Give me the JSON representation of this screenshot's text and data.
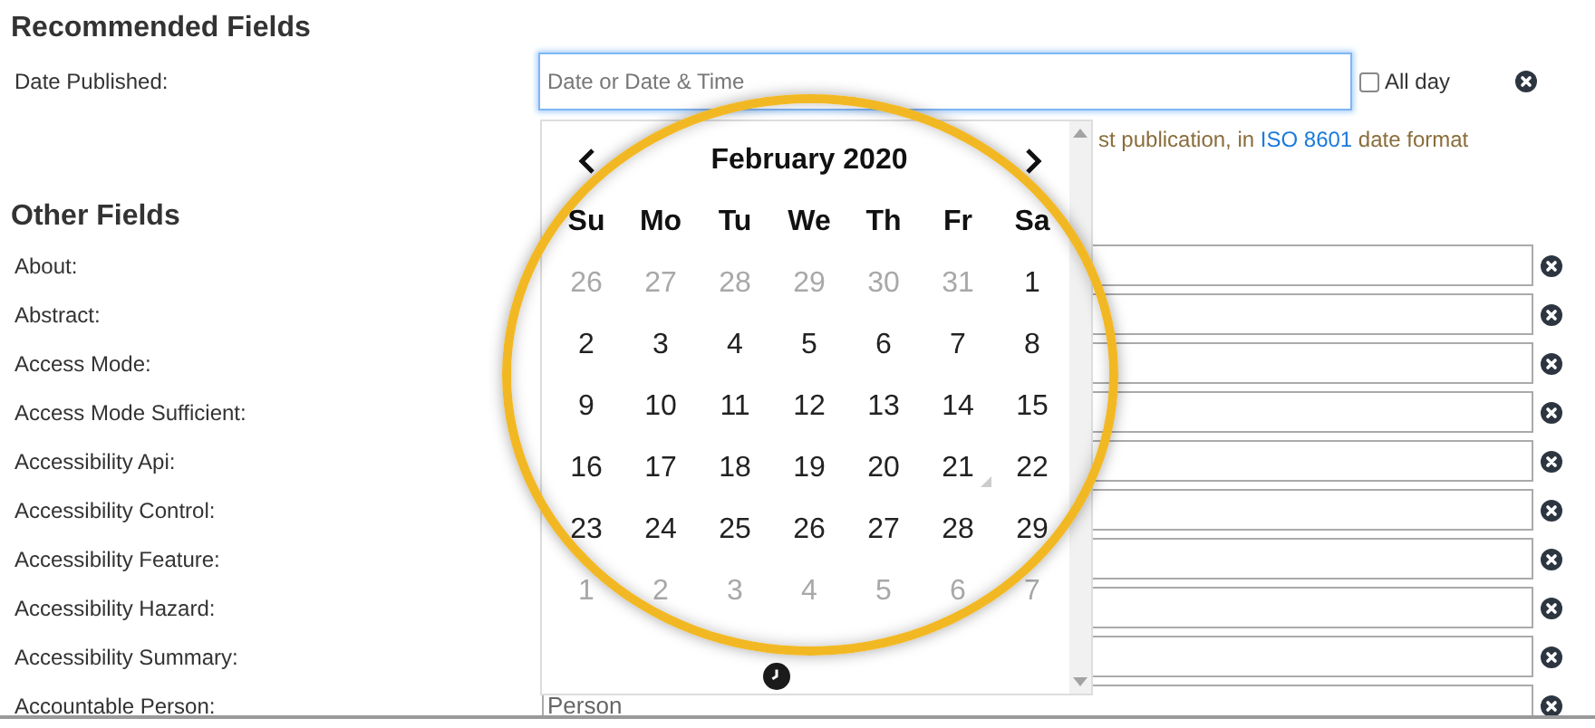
{
  "recommended": {
    "title": "Recommended Fields",
    "date_field": {
      "label": "Date Published:",
      "placeholder": "Date or Date & Time",
      "focused": true
    },
    "all_day": {
      "label": "All day",
      "checked": false
    },
    "help": {
      "before": "st publication, in ",
      "link": "ISO 8601",
      "after": " date format"
    }
  },
  "calendar": {
    "month": "February 2020",
    "weekdays": [
      "Su",
      "Mo",
      "Tu",
      "We",
      "Th",
      "Fr",
      "Sa"
    ],
    "weeks": [
      [
        {
          "day": "26",
          "muted": true,
          "today": false
        },
        {
          "day": "27",
          "muted": true,
          "today": false
        },
        {
          "day": "28",
          "muted": true,
          "today": false
        },
        {
          "day": "29",
          "muted": true,
          "today": false
        },
        {
          "day": "30",
          "muted": true,
          "today": false
        },
        {
          "day": "31",
          "muted": true,
          "today": false
        },
        {
          "day": "1",
          "muted": false,
          "today": false
        }
      ],
      [
        {
          "day": "2",
          "muted": false,
          "today": false
        },
        {
          "day": "3",
          "muted": false,
          "today": false
        },
        {
          "day": "4",
          "muted": false,
          "today": false
        },
        {
          "day": "5",
          "muted": false,
          "today": false
        },
        {
          "day": "6",
          "muted": false,
          "today": false
        },
        {
          "day": "7",
          "muted": false,
          "today": false
        },
        {
          "day": "8",
          "muted": false,
          "today": false
        }
      ],
      [
        {
          "day": "9",
          "muted": false,
          "today": false
        },
        {
          "day": "10",
          "muted": false,
          "today": false
        },
        {
          "day": "11",
          "muted": false,
          "today": false
        },
        {
          "day": "12",
          "muted": false,
          "today": false
        },
        {
          "day": "13",
          "muted": false,
          "today": false
        },
        {
          "day": "14",
          "muted": false,
          "today": false
        },
        {
          "day": "15",
          "muted": false,
          "today": false
        }
      ],
      [
        {
          "day": "16",
          "muted": false,
          "today": false
        },
        {
          "day": "17",
          "muted": false,
          "today": false
        },
        {
          "day": "18",
          "muted": false,
          "today": false
        },
        {
          "day": "19",
          "muted": false,
          "today": false
        },
        {
          "day": "20",
          "muted": false,
          "today": false
        },
        {
          "day": "21",
          "muted": false,
          "today": true
        },
        {
          "day": "22",
          "muted": false,
          "today": false
        }
      ],
      [
        {
          "day": "23",
          "muted": false,
          "today": false
        },
        {
          "day": "24",
          "muted": false,
          "today": false
        },
        {
          "day": "25",
          "muted": false,
          "today": false
        },
        {
          "day": "26",
          "muted": false,
          "today": false
        },
        {
          "day": "27",
          "muted": false,
          "today": false
        },
        {
          "day": "28",
          "muted": false,
          "today": false
        },
        {
          "day": "29",
          "muted": false,
          "today": false
        }
      ],
      [
        {
          "day": "1",
          "muted": true,
          "today": false
        },
        {
          "day": "2",
          "muted": true,
          "today": false
        },
        {
          "day": "3",
          "muted": true,
          "today": false
        },
        {
          "day": "4",
          "muted": true,
          "today": false
        },
        {
          "day": "5",
          "muted": true,
          "today": false
        },
        {
          "day": "6",
          "muted": true,
          "today": false
        },
        {
          "day": "7",
          "muted": true,
          "today": false
        }
      ]
    ]
  },
  "other": {
    "title": "Other Fields",
    "fields": [
      {
        "label": "About:"
      },
      {
        "label": "Abstract:"
      },
      {
        "label": "Access Mode:"
      },
      {
        "label": "Access Mode Sufficient:"
      },
      {
        "label": "Accessibility Api:"
      },
      {
        "label": "Accessibility Control:"
      },
      {
        "label": "Accessibility Feature:"
      },
      {
        "label": "Accessibility Hazard:"
      },
      {
        "label": "Accessibility Summary:"
      },
      {
        "label": "Accountable Person:",
        "placeholder": "Person"
      }
    ]
  }
}
